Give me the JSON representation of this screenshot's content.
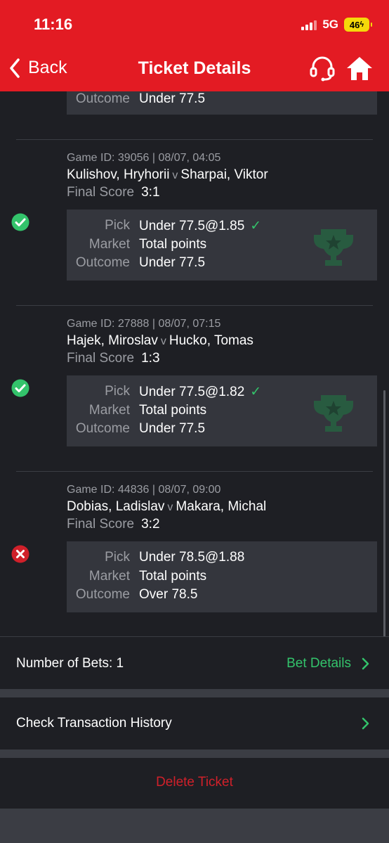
{
  "status_bar": {
    "time": "11:16",
    "network": "5G",
    "battery": "46"
  },
  "nav": {
    "back_label": "Back",
    "title": "Ticket Details"
  },
  "top_partial": {
    "outcome_label": "Outcome",
    "outcome_value": "Under 77.5"
  },
  "tickets": [
    {
      "game_id": "Game ID: 39056 | 08/07, 04:05",
      "home": "Kulishov, Hryhorii",
      "vs": "v",
      "away": "Sharpai, Viktor",
      "final_label": "Final Score",
      "final_score": "3:1",
      "status": "won",
      "pick_label": "Pick",
      "pick_value": "Under 77.5@1.85",
      "pick_check": "✓",
      "market_label": "Market",
      "market_value": "Total points",
      "outcome_label": "Outcome",
      "outcome_value": "Under 77.5"
    },
    {
      "game_id": "Game ID: 27888 | 08/07, 07:15",
      "home": "Hajek, Miroslav",
      "vs": "v",
      "away": "Hucko, Tomas",
      "final_label": "Final Score",
      "final_score": "1:3",
      "status": "won",
      "pick_label": "Pick",
      "pick_value": "Under 77.5@1.82",
      "pick_check": "✓",
      "market_label": "Market",
      "market_value": "Total points",
      "outcome_label": "Outcome",
      "outcome_value": "Under 77.5"
    },
    {
      "game_id": "Game ID: 44836 | 08/07, 09:00",
      "home": "Dobias, Ladislav",
      "vs": "v",
      "away": "Makara, Michal",
      "final_label": "Final Score",
      "final_score": "3:2",
      "status": "lost",
      "pick_label": "Pick",
      "pick_value": "Under 78.5@1.88",
      "market_label": "Market",
      "market_value": "Total points",
      "outcome_label": "Outcome",
      "outcome_value": "Over 78.5"
    }
  ],
  "summary": {
    "number_of_bets": "Number of Bets: 1",
    "bet_details": "Bet Details",
    "check_history": "Check Transaction History",
    "delete_ticket": "Delete Ticket"
  },
  "colors": {
    "brand_red": "#e31b23",
    "win_green": "#33c36b",
    "loss_red": "#d0202a",
    "background": "#1e1f24",
    "card": "#34363d"
  },
  "icons": [
    "chevron-left-icon",
    "headset-icon",
    "home-icon",
    "check-circle-icon",
    "x-circle-icon",
    "trophy-icon",
    "chevron-right-icon"
  ]
}
